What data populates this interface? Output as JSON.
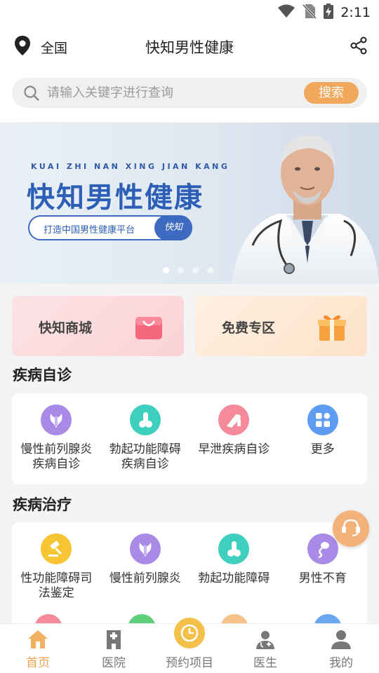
{
  "status_bar": {
    "time": "2:11",
    "icons": [
      "wifi-icon",
      "no-sim-icon",
      "battery-charging-icon"
    ]
  },
  "header": {
    "location": "全国",
    "title": "快知男性健康",
    "share_icon": "share-icon",
    "location_icon": "location-pin-icon"
  },
  "search": {
    "placeholder": "请输入关键字进行查询",
    "value": "",
    "button": "搜索"
  },
  "banner": {
    "pinyin": "KUAI ZHI NAN XING JIAN KANG",
    "headline": "快知男性健康",
    "slogan": "打造中国男性健康平台",
    "brand": "快知",
    "dots": 4,
    "active_dot": 0
  },
  "quick_cards": [
    {
      "label": "快知商城",
      "icon": "shopping-bag-icon"
    },
    {
      "label": "免费专区",
      "icon": "gift-icon"
    }
  ],
  "self_diagnosis": {
    "title": "疾病自诊",
    "items": [
      {
        "label": "慢性前列腺炎疾病自诊",
        "line1": "慢性前列腺炎",
        "line2": "疾病自诊",
        "icon": "prostate-icon",
        "color": "#a98ae6"
      },
      {
        "label": "勃起功能障碍疾病自诊",
        "line1": "勃起功能障碍",
        "line2": "疾病自诊",
        "icon": "ed-icon",
        "color": "#3fcfbf"
      },
      {
        "label": "早泄疾病自诊",
        "line1": "早泄疾病自诊",
        "line2": "",
        "icon": "pe-icon",
        "color": "#f48a9a"
      },
      {
        "label": "更多",
        "line1": "更多",
        "line2": "",
        "icon": "more-grid-icon",
        "color": "#5d9cf0"
      }
    ]
  },
  "treatment": {
    "title": "疾病治疗",
    "items": [
      {
        "label": "性功能障碍司法鉴定",
        "line1": "性功能障碍司",
        "line2": "法鉴定",
        "icon": "gavel-icon",
        "color": "#f7c531"
      },
      {
        "label": "慢性前列腺炎",
        "line1": "慢性前列腺炎",
        "line2": "",
        "icon": "prostate-icon",
        "color": "#a98ae6"
      },
      {
        "label": "勃起功能障碍",
        "line1": "勃起功能障碍",
        "line2": "",
        "icon": "ed-icon",
        "color": "#3fcfbf"
      },
      {
        "label": "男性不育",
        "line1": "男性不育",
        "line2": "",
        "icon": "sperm-icon",
        "color": "#a98ae6"
      }
    ]
  },
  "tabbar": [
    {
      "label": "首页",
      "icon": "home-icon",
      "active": true
    },
    {
      "label": "医院",
      "icon": "hospital-icon",
      "active": false
    },
    {
      "label": "预约项目",
      "icon": "clock-icon",
      "active": false
    },
    {
      "label": "医生",
      "icon": "doctor-icon",
      "active": false
    },
    {
      "label": "我的",
      "icon": "user-icon",
      "active": false
    }
  ],
  "colors": {
    "accent": "#f1a85a",
    "brand_blue": "#2c5fb5",
    "active_tab": "#f0a14f"
  }
}
